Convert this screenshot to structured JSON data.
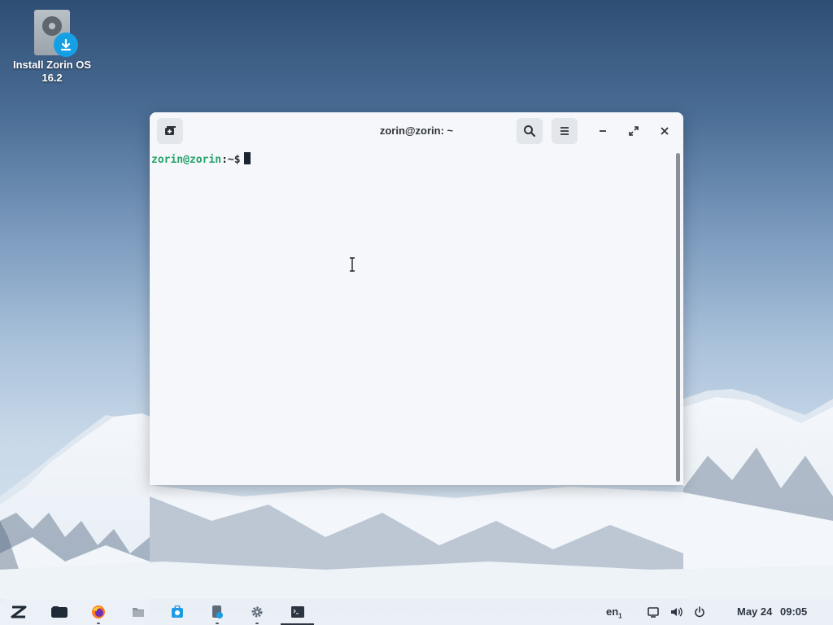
{
  "desktop": {
    "install_icon": {
      "label_line1": "Install Zorin OS",
      "label_line2": "16.2",
      "icon": "disk-install-icon"
    }
  },
  "terminal": {
    "title": "zorin@zorin: ~",
    "prompt_user": "zorin@zorin",
    "prompt_sep": ":~$",
    "icons": {
      "new_tab": "new-tab-icon",
      "search": "search-icon",
      "menu": "hamburger-menu-icon",
      "minimize": "minimize-icon",
      "maximize": "maximize-icon",
      "close": "close-icon"
    },
    "colors": {
      "prompt_user": "#26a269",
      "background": "#f5f7fa"
    }
  },
  "taskbar": {
    "apps": [
      {
        "name": "zorin-menu",
        "icon": "zorin-logo-icon"
      },
      {
        "name": "show-desktop",
        "icon": "workspaces-icon"
      },
      {
        "name": "firefox",
        "icon": "firefox-icon"
      },
      {
        "name": "files",
        "icon": "files-icon"
      },
      {
        "name": "software",
        "icon": "software-store-icon"
      },
      {
        "name": "zorin-connect",
        "icon": "connect-icon"
      },
      {
        "name": "settings",
        "icon": "gear-icon"
      },
      {
        "name": "terminal",
        "icon": "terminal-icon"
      }
    ],
    "keyboard_layout": "en",
    "keyboard_layout_sub": "1",
    "date": "May 24",
    "time": "09:05"
  }
}
